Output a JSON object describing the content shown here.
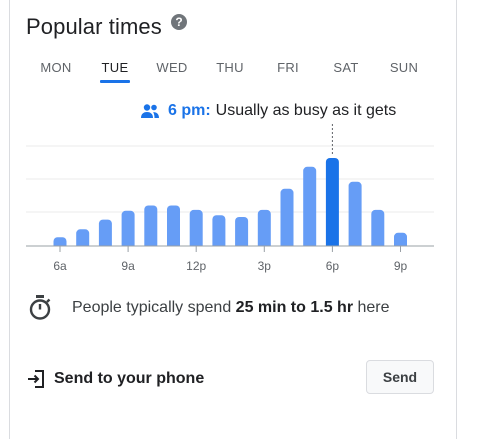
{
  "title": "Popular times",
  "icons": {
    "help": "help-circle-icon",
    "people": "people-icon",
    "timer": "stopwatch-icon",
    "send": "send-to-phone-icon"
  },
  "days": [
    {
      "label": "MON"
    },
    {
      "label": "TUE",
      "selected": true
    },
    {
      "label": "WED"
    },
    {
      "label": "THU"
    },
    {
      "label": "FRI"
    },
    {
      "label": "SAT"
    },
    {
      "label": "SUN"
    }
  ],
  "busy": {
    "time": "6 pm:",
    "description": "Usually as busy as it gets"
  },
  "dwell": {
    "prefix": "People typically spend",
    "duration": "25 min to 1.5 hr",
    "suffix": "here"
  },
  "send": {
    "label": "Send to your phone",
    "button": "Send"
  },
  "colors": {
    "accent": "#1a73e8",
    "bar": "#669df6",
    "bar_selected": "#1a73e8",
    "text": "#202124",
    "muted": "#5f6368"
  },
  "chart_data": {
    "type": "bar",
    "categories": [
      "6a",
      "7a",
      "8a",
      "9a",
      "10a",
      "11a",
      "12p",
      "1p",
      "2p",
      "3p",
      "4p",
      "5p",
      "6p",
      "7p",
      "8p",
      "9p"
    ],
    "tick_labels": [
      "6a",
      "9a",
      "12p",
      "3p",
      "6p",
      "9p"
    ],
    "values": [
      10,
      19,
      30,
      40,
      46,
      46,
      41,
      35,
      33,
      41,
      65,
      90,
      100,
      73,
      41,
      15
    ],
    "highlighted": "6p",
    "ylim": [
      0,
      100
    ],
    "grid": true
  }
}
